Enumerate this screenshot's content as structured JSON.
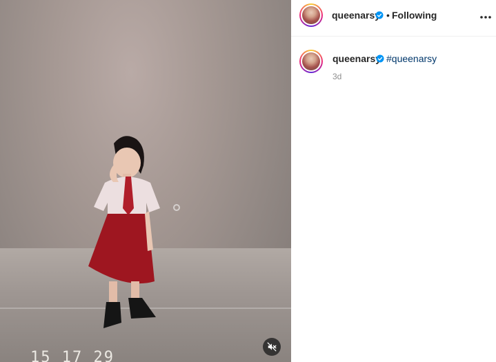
{
  "post": {
    "timestamp_overlay": "15 17 29",
    "mute_icon": "muted-speaker-icon"
  },
  "header": {
    "username": "queenarsy",
    "separator": "•",
    "follow_status": "Following",
    "more_icon": "more-options-icon"
  },
  "caption": {
    "username": "queenarsy",
    "hashtag": "#queenarsy",
    "time_ago": "3d"
  },
  "colors": {
    "verified": "#0095f6",
    "hashtag_link": "#00376b",
    "text_primary": "#262626",
    "text_secondary": "#8e8e8e"
  }
}
